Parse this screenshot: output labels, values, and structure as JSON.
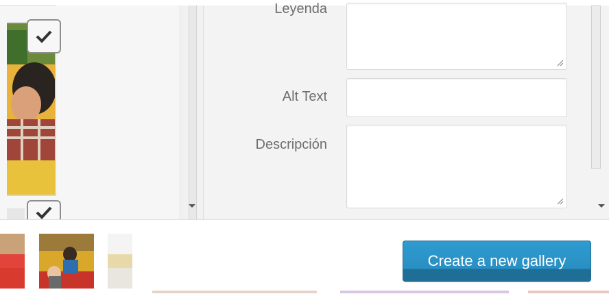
{
  "attachment_details": {
    "caption_label": "Leyenda",
    "caption_value": "",
    "alt_label": "Alt Text",
    "alt_value": "",
    "description_label": "Descripción",
    "description_value": ""
  },
  "toolbar": {
    "create_gallery_label": "Create a new gallery"
  },
  "colors": {
    "primary_button": "#2a8fc2",
    "primary_button_dark": "#1f6e95",
    "panel_bg": "#f3f3f3"
  },
  "icons": {
    "selected": "checkmark-icon",
    "resize": "resize-handle-icon",
    "scroll_down": "chevron-down-icon"
  }
}
